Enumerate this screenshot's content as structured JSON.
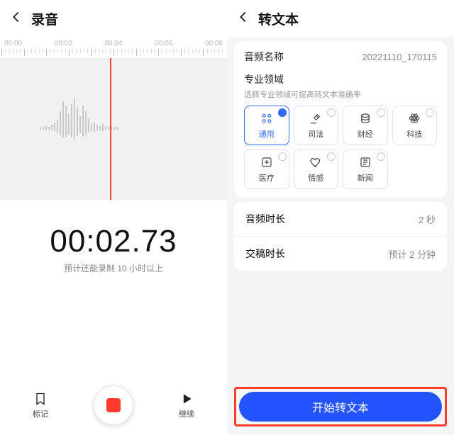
{
  "left": {
    "title": "录音",
    "ruler": [
      "00:00",
      "00:02",
      "00:04",
      "00:06",
      "00:08"
    ],
    "timer": "00:02.73",
    "timer_sub": "预计还能录制 10 小时以上",
    "controls": {
      "bookmark": "标记",
      "continue": "继续"
    }
  },
  "right": {
    "title": "转文本",
    "audio_name_label": "音频名称",
    "audio_name_value": "20221110_170115",
    "domain_title": "专业领域",
    "domain_sub": "选择专业领域可提高转文本准确率",
    "domains": [
      {
        "label": "通用",
        "icon": "grid",
        "selected": true
      },
      {
        "label": "司法",
        "icon": "gavel",
        "selected": false
      },
      {
        "label": "财经",
        "icon": "coins",
        "selected": false
      },
      {
        "label": "科技",
        "icon": "atom",
        "selected": false
      },
      {
        "label": "医疗",
        "icon": "medical",
        "selected": false
      },
      {
        "label": "情感",
        "icon": "heart",
        "selected": false
      },
      {
        "label": "新闻",
        "icon": "news",
        "selected": false
      }
    ],
    "audio_duration_label": "音频时长",
    "audio_duration_value": "2 秒",
    "delivery_label": "交稿时长",
    "delivery_value": "预计 2 分钟",
    "start_button": "开始转文本"
  }
}
